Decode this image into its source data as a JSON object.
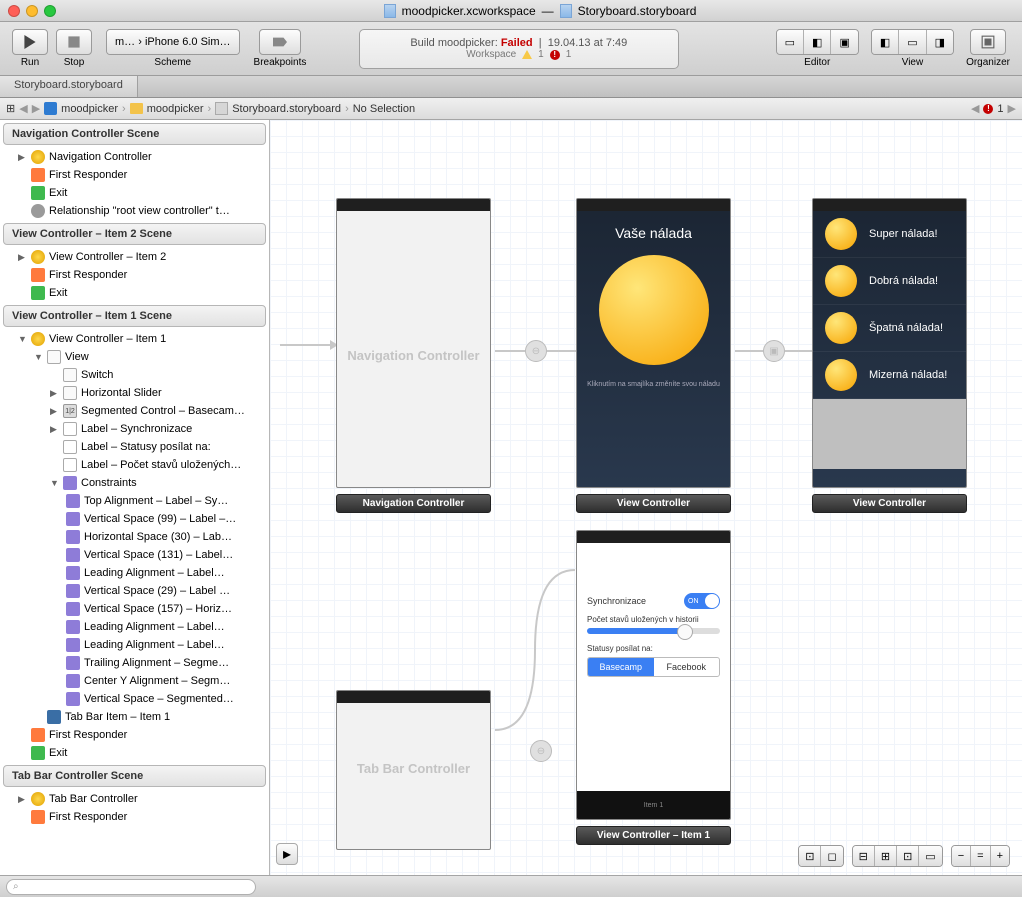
{
  "title": {
    "left": "moodpicker.xcworkspace",
    "right": "Storyboard.storyboard"
  },
  "toolbar": {
    "run": "Run",
    "stop": "Stop",
    "scheme": "Scheme",
    "scheme_value": "m… › iPhone 6.0 Sim…",
    "breakpoints": "Breakpoints",
    "status_line1_prefix": "Build moodpicker: ",
    "status_line1_result": "Failed",
    "status_line1_time": "19.04.13 at 7:49",
    "status_line2": "Workspace",
    "status_warn_count": "1",
    "status_err_count": "1",
    "editor": "Editor",
    "view": "View",
    "organizer": "Organizer"
  },
  "tabs": [
    "Storyboard.storyboard"
  ],
  "jumpbar": {
    "items": [
      "moodpicker",
      "moodpicker",
      "Storyboard.storyboard",
      "No Selection"
    ],
    "err_count": "1"
  },
  "outline": {
    "s1": {
      "title": "Navigation Controller Scene",
      "rows": [
        "Navigation Controller",
        "First Responder",
        "Exit",
        "Relationship \"root view controller\" t…"
      ]
    },
    "s2": {
      "title": "View Controller – Item 2 Scene",
      "rows": [
        "View Controller – Item 2",
        "First Responder",
        "Exit"
      ]
    },
    "s3": {
      "title": "View Controller – Item 1 Scene",
      "root": "View Controller – Item 1",
      "view": "View",
      "children": [
        "Switch",
        "Horizontal Slider",
        "Segmented Control – Basecam…",
        "Label – Synchronizace",
        "Label – Statusy posílat na:",
        "Label – Počet stavů uložených…"
      ],
      "constraints_label": "Constraints",
      "constraints": [
        "Top Alignment – Label – Sy…",
        "Vertical Space (99) – Label –…",
        "Horizontal Space (30) – Lab…",
        "Vertical Space (131) – Label…",
        "Leading Alignment – Label…",
        "Vertical Space (29) – Label …",
        "Vertical Space (157) – Horiz…",
        "Leading Alignment – Label…",
        "Leading Alignment – Label…",
        "Trailing Alignment – Segme…",
        "Center Y Alignment – Segm…",
        "Vertical Space – Segmented…"
      ],
      "tabbar_item": "Tab Bar Item – Item 1",
      "tail": [
        "First Responder",
        "Exit"
      ]
    },
    "s4": {
      "title": "Tab Bar Controller Scene",
      "rows": [
        "Tab Bar Controller",
        "First Responder"
      ]
    }
  },
  "canvas": {
    "nav_label": "Navigation Controller",
    "nav_caption": "Navigation Controller",
    "vc1_title": "Vaše nálada",
    "vc1_hint": "Kliknutím na smajlíka změníte svou náladu",
    "vc1_caption": "View Controller",
    "vc2_moods": [
      "Super nálada!",
      "Dobrá nálada!",
      "Špatná nálada!",
      "Mizerná nálada!"
    ],
    "vc2_caption": "View Controller",
    "settings": {
      "sync": "Synchronizace",
      "switch_label": "ON",
      "slider": "Počet stavů uložených v historii",
      "seg_label": "Statusy posílat na:",
      "seg_a": "Basecamp",
      "seg_b": "Facebook",
      "tab": "Item 1",
      "caption": "View Controller – Item 1"
    },
    "tab_label": "Tab Bar Controller"
  }
}
